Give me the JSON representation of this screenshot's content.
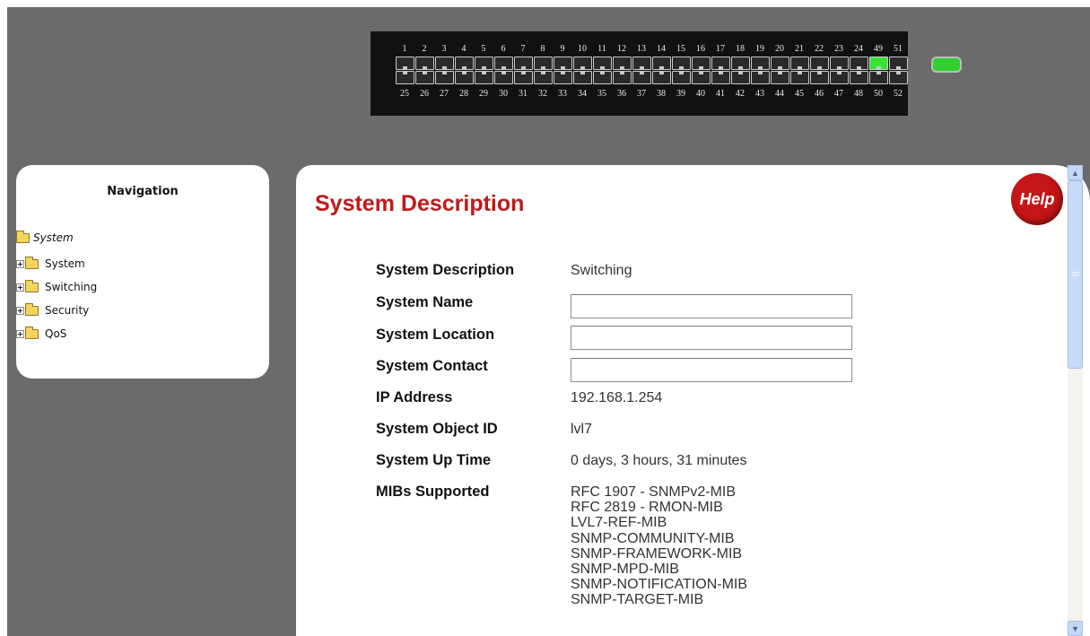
{
  "switch": {
    "top_ports": [
      "1",
      "2",
      "3",
      "4",
      "5",
      "6",
      "7",
      "8",
      "9",
      "10",
      "11",
      "12",
      "13",
      "14",
      "15",
      "16",
      "17",
      "18",
      "19",
      "20",
      "21",
      "22",
      "23",
      "24",
      "49",
      "51"
    ],
    "bottom_ports": [
      "25",
      "26",
      "27",
      "28",
      "29",
      "30",
      "31",
      "32",
      "33",
      "34",
      "35",
      "36",
      "37",
      "38",
      "39",
      "40",
      "41",
      "42",
      "43",
      "44",
      "45",
      "46",
      "47",
      "48",
      "50",
      "52"
    ],
    "active_port": "49",
    "active_color": "#36e436"
  },
  "navigation": {
    "title": "Navigation",
    "root": "System",
    "items": [
      {
        "label": "System"
      },
      {
        "label": "Switching"
      },
      {
        "label": "Security"
      },
      {
        "label": "QoS"
      }
    ]
  },
  "main": {
    "title": "System Description",
    "help_label": "Help",
    "accent_color": "#bf1a1a",
    "rows": {
      "description": {
        "label": "System Description",
        "value": "Switching"
      },
      "name": {
        "label": "System Name",
        "value": ""
      },
      "location": {
        "label": "System Location",
        "value": ""
      },
      "contact": {
        "label": "System Contact",
        "value": ""
      },
      "ip": {
        "label": "IP Address",
        "value": "192.168.1.254"
      },
      "object_id": {
        "label": "System Object ID",
        "value": "lvl7"
      },
      "uptime": {
        "label": "System Up Time",
        "value": "0 days, 3 hours, 31 minutes"
      },
      "mibs": {
        "label": "MIBs Supported"
      }
    },
    "mibs": [
      "RFC 1907 - SNMPv2-MIB",
      "RFC 2819 - RMON-MIB",
      "LVL7-REF-MIB",
      "SNMP-COMMUNITY-MIB",
      "SNMP-FRAMEWORK-MIB",
      "SNMP-MPD-MIB",
      "SNMP-NOTIFICATION-MIB",
      "SNMP-TARGET-MIB"
    ]
  },
  "icons": {
    "help": "help-icon",
    "folder": "folder-icon",
    "expand": "plus-expand-icon",
    "scroll_up": "scroll-up-icon",
    "scroll_down": "scroll-down-icon"
  }
}
